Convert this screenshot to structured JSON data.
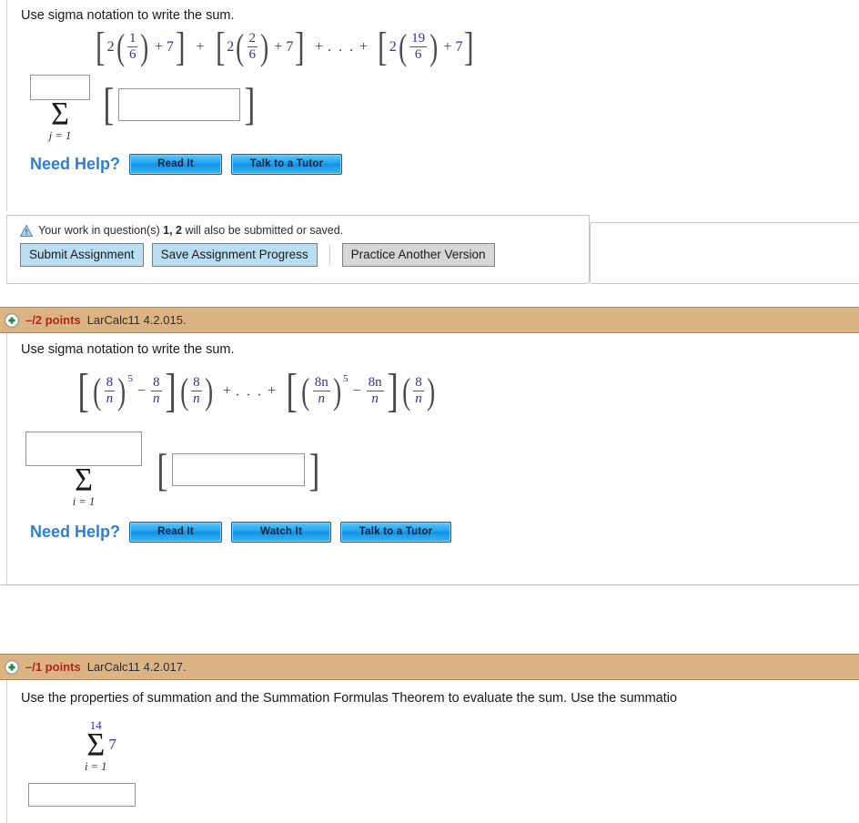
{
  "question1": {
    "prompt": "Use sigma notation to write the sum.",
    "expression": {
      "terms": [
        {
          "coefficient": "2",
          "fraction": {
            "numerator": "1",
            "denominator": "6"
          },
          "addend": "7"
        },
        {
          "coefficient": "2",
          "fraction": {
            "numerator": "2",
            "denominator": "6"
          },
          "addend": "7"
        },
        {
          "coefficient": "2",
          "fraction": {
            "numerator": "19",
            "denominator": "6"
          },
          "addend": "7"
        }
      ],
      "plus": "+",
      "ellipsis": ". . .",
      "open_bracket": "[",
      "close_bracket": "]",
      "open_paren": "(",
      "close_paren": ")"
    },
    "answer": {
      "upper_limit_value": "",
      "sigma_glyph": "Σ",
      "lower_limit": "j = 1",
      "body_value": ""
    },
    "need_help": {
      "label": "Need Help?",
      "buttons": [
        "Read It",
        "Talk to a Tutor"
      ]
    }
  },
  "submit_panel": {
    "warning_icon": "warning-triangle-icon",
    "warning_text_before": "Your work in question(s)",
    "warning_questions": "1, 2",
    "warning_text_after": "will also be submitted or saved.",
    "buttons": {
      "submit": "Submit Assignment",
      "save": "Save Assignment Progress",
      "practice": "Practice Another Version"
    }
  },
  "question2": {
    "header": {
      "icon": "plus-circle-icon",
      "points": "–/2 points",
      "reference": "LarCalc11 4.2.015."
    },
    "prompt": "Use sigma notation to write the sum.",
    "expression": {
      "first_group": {
        "base": {
          "numerator": "8",
          "denominator": "n"
        },
        "exponent": "5",
        "minus": "−",
        "subtracted": {
          "numerator": "8",
          "denominator": "n"
        },
        "multiplier": {
          "numerator": "8",
          "denominator": "n"
        }
      },
      "last_group": {
        "base": {
          "numerator": "8n",
          "denominator": "n"
        },
        "exponent": "5",
        "minus": "−",
        "subtracted": {
          "numerator": "8n",
          "denominator": "n"
        },
        "multiplier": {
          "numerator": "8",
          "denominator": "n"
        }
      },
      "plus": "+",
      "ellipsis": ". . .",
      "open_bracket": "[",
      "close_bracket": "]"
    },
    "answer": {
      "upper_limit_value": "",
      "sigma_glyph": "Σ",
      "lower_limit": "i = 1",
      "body_value": ""
    },
    "need_help": {
      "label": "Need Help?",
      "buttons": [
        "Read It",
        "Watch It",
        "Talk to a Tutor"
      ]
    }
  },
  "question3": {
    "header": {
      "icon": "plus-circle-icon",
      "points": "–/1 points",
      "reference": "LarCalc11 4.2.017."
    },
    "prompt": "Use the properties of summation and the Summation Formulas Theorem to evaluate the sum. Use the summatio",
    "expression": {
      "upper_limit": "14",
      "sigma_glyph": "Σ",
      "lower_limit": "i = 1",
      "summand": "7"
    },
    "answer": {
      "value": ""
    }
  },
  "colors": {
    "header_bar": "#dcb382",
    "header_border": "#a88a62",
    "points_text": "#b3241c",
    "math_number": "#2f2fae",
    "need_help_label": "#2f7fd0",
    "help_button": "#23a4ef",
    "submit_button": "#b9def2",
    "practice_button": "#d6d6d6",
    "input_border": "#949494"
  }
}
